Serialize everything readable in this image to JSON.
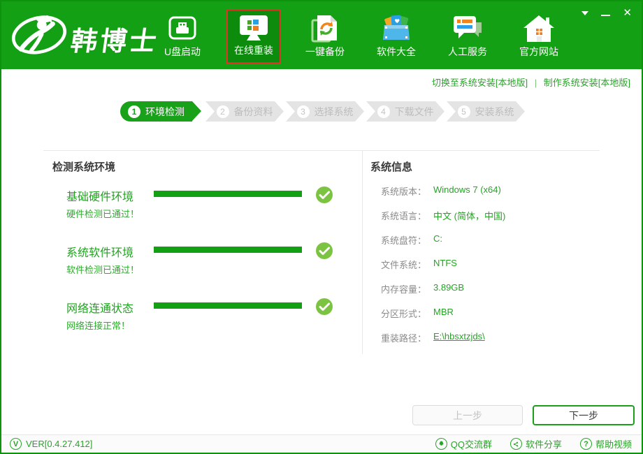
{
  "window_controls": {
    "dropdown": "menu",
    "minimize": "minimize",
    "close_glyph": "✕"
  },
  "header": {
    "brand": "韩博士",
    "nav": [
      {
        "label": "U盘启动",
        "active": false
      },
      {
        "label": "在线重装",
        "active": true
      },
      {
        "label": "一键备份",
        "active": false
      },
      {
        "label": "软件大全",
        "active": false
      },
      {
        "label": "人工服务",
        "active": false
      },
      {
        "label": "官方网站",
        "active": false
      }
    ]
  },
  "subheader": {
    "links": [
      "切换至系统安装[本地版]",
      "制作系统安装[本地版]"
    ],
    "separator": "|"
  },
  "steps": {
    "items": [
      {
        "num": "1",
        "label": "环境检测",
        "active": true
      },
      {
        "num": "2",
        "label": "备份资料",
        "active": false
      },
      {
        "num": "3",
        "label": "选择系统",
        "active": false
      },
      {
        "num": "4",
        "label": "下载文件",
        "active": false
      },
      {
        "num": "5",
        "label": "安装系统",
        "active": false
      }
    ]
  },
  "detection": {
    "title": "检测系统环境",
    "items": [
      {
        "name": "基础硬件环境",
        "progress": "100%",
        "status": "硬件检测已通过！"
      },
      {
        "name": "系统软件环境",
        "progress": "100%",
        "status": "软件检测已通过！"
      },
      {
        "name": "网络连通状态",
        "progress": "100%",
        "status": "网络连接正常！"
      }
    ]
  },
  "sysinfo": {
    "title": "系统信息",
    "rows": [
      {
        "label": "系统版本：",
        "value": "Windows 7 (x64)"
      },
      {
        "label": "系统语言：",
        "value": "中文 (简体，中国)"
      },
      {
        "label": "系统盘符：",
        "value": "C:"
      },
      {
        "label": "文件系统：",
        "value": "NTFS"
      },
      {
        "label": "内存容量：",
        "value": "3.89GB"
      },
      {
        "label": "分区形式：",
        "value": "MBR"
      },
      {
        "label": "重装路径：",
        "value": "E:\\hbsxtzjds\\"
      }
    ]
  },
  "buttons": {
    "prev": "上一步",
    "next": "下一步"
  },
  "footer": {
    "version": "VER[0.4.27.412]",
    "version_icon_glyph": "V",
    "links": [
      "QQ交流群",
      "软件分享",
      "帮助视频"
    ],
    "help_glyph": "?"
  },
  "colors": {
    "brand_green": "#14a014",
    "active_tab_green": "#0c8b0c",
    "highlight_red": "#e03228",
    "check_green": "#7cc342",
    "link_green": "#2aa32a"
  }
}
